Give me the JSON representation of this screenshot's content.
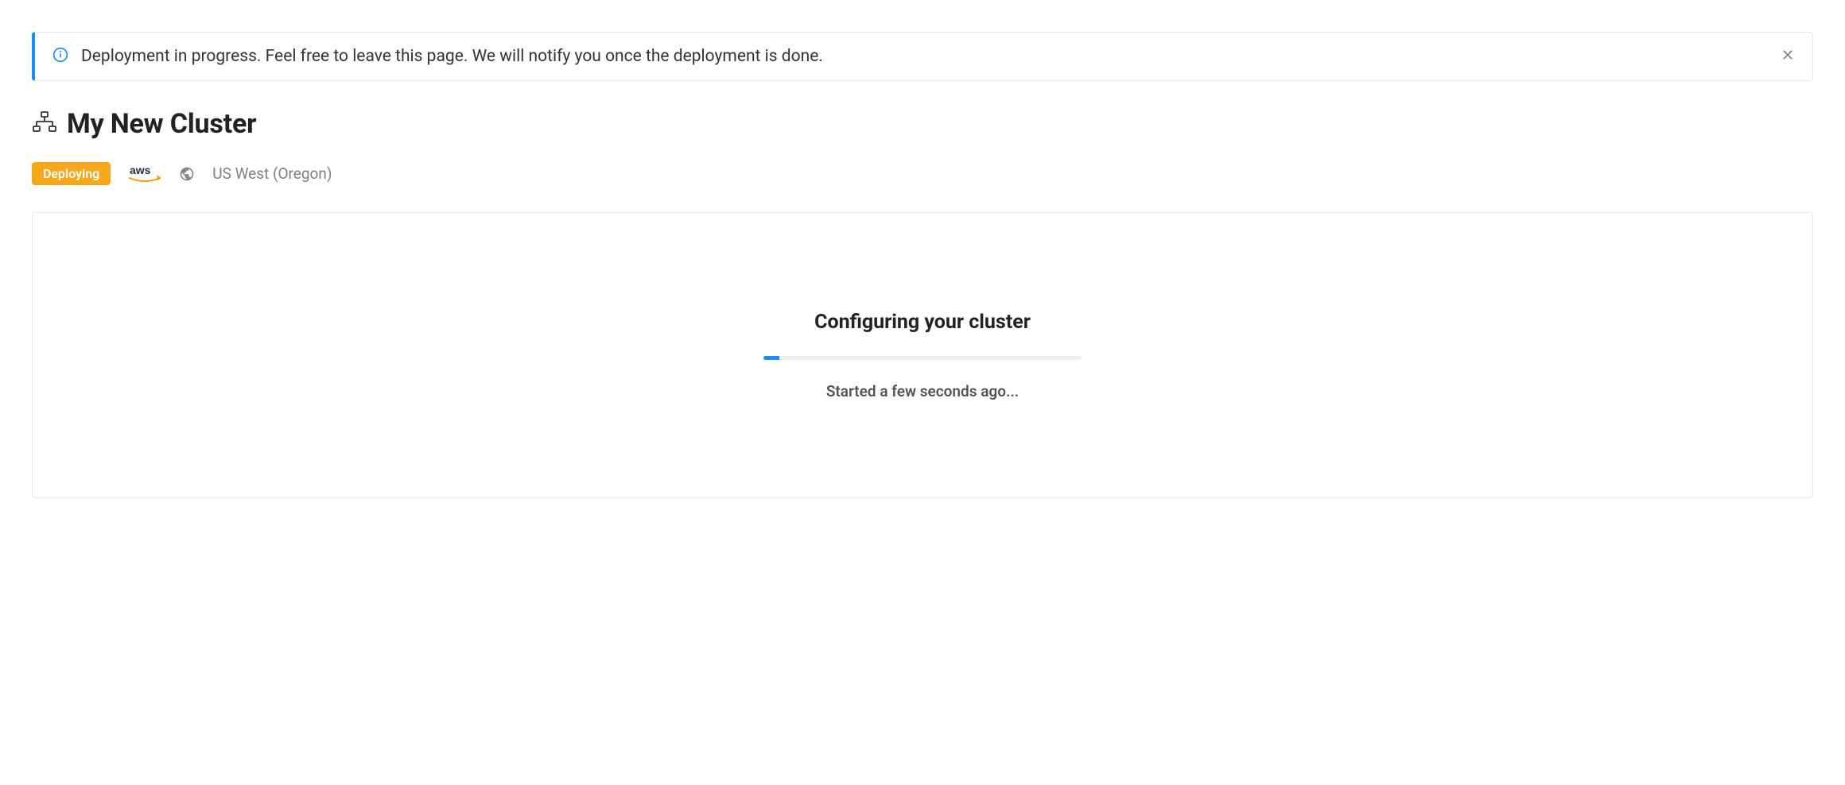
{
  "notification": {
    "message": "Deployment in progress. Feel free to leave this page. We will notify you once the deployment is done."
  },
  "header": {
    "title": "My New Cluster"
  },
  "meta": {
    "status_badge": "Deploying",
    "provider": "aws",
    "region": "US West (Oregon)"
  },
  "panel": {
    "heading": "Configuring your cluster",
    "progress_percent": 5,
    "status": "Started a few seconds ago..."
  }
}
